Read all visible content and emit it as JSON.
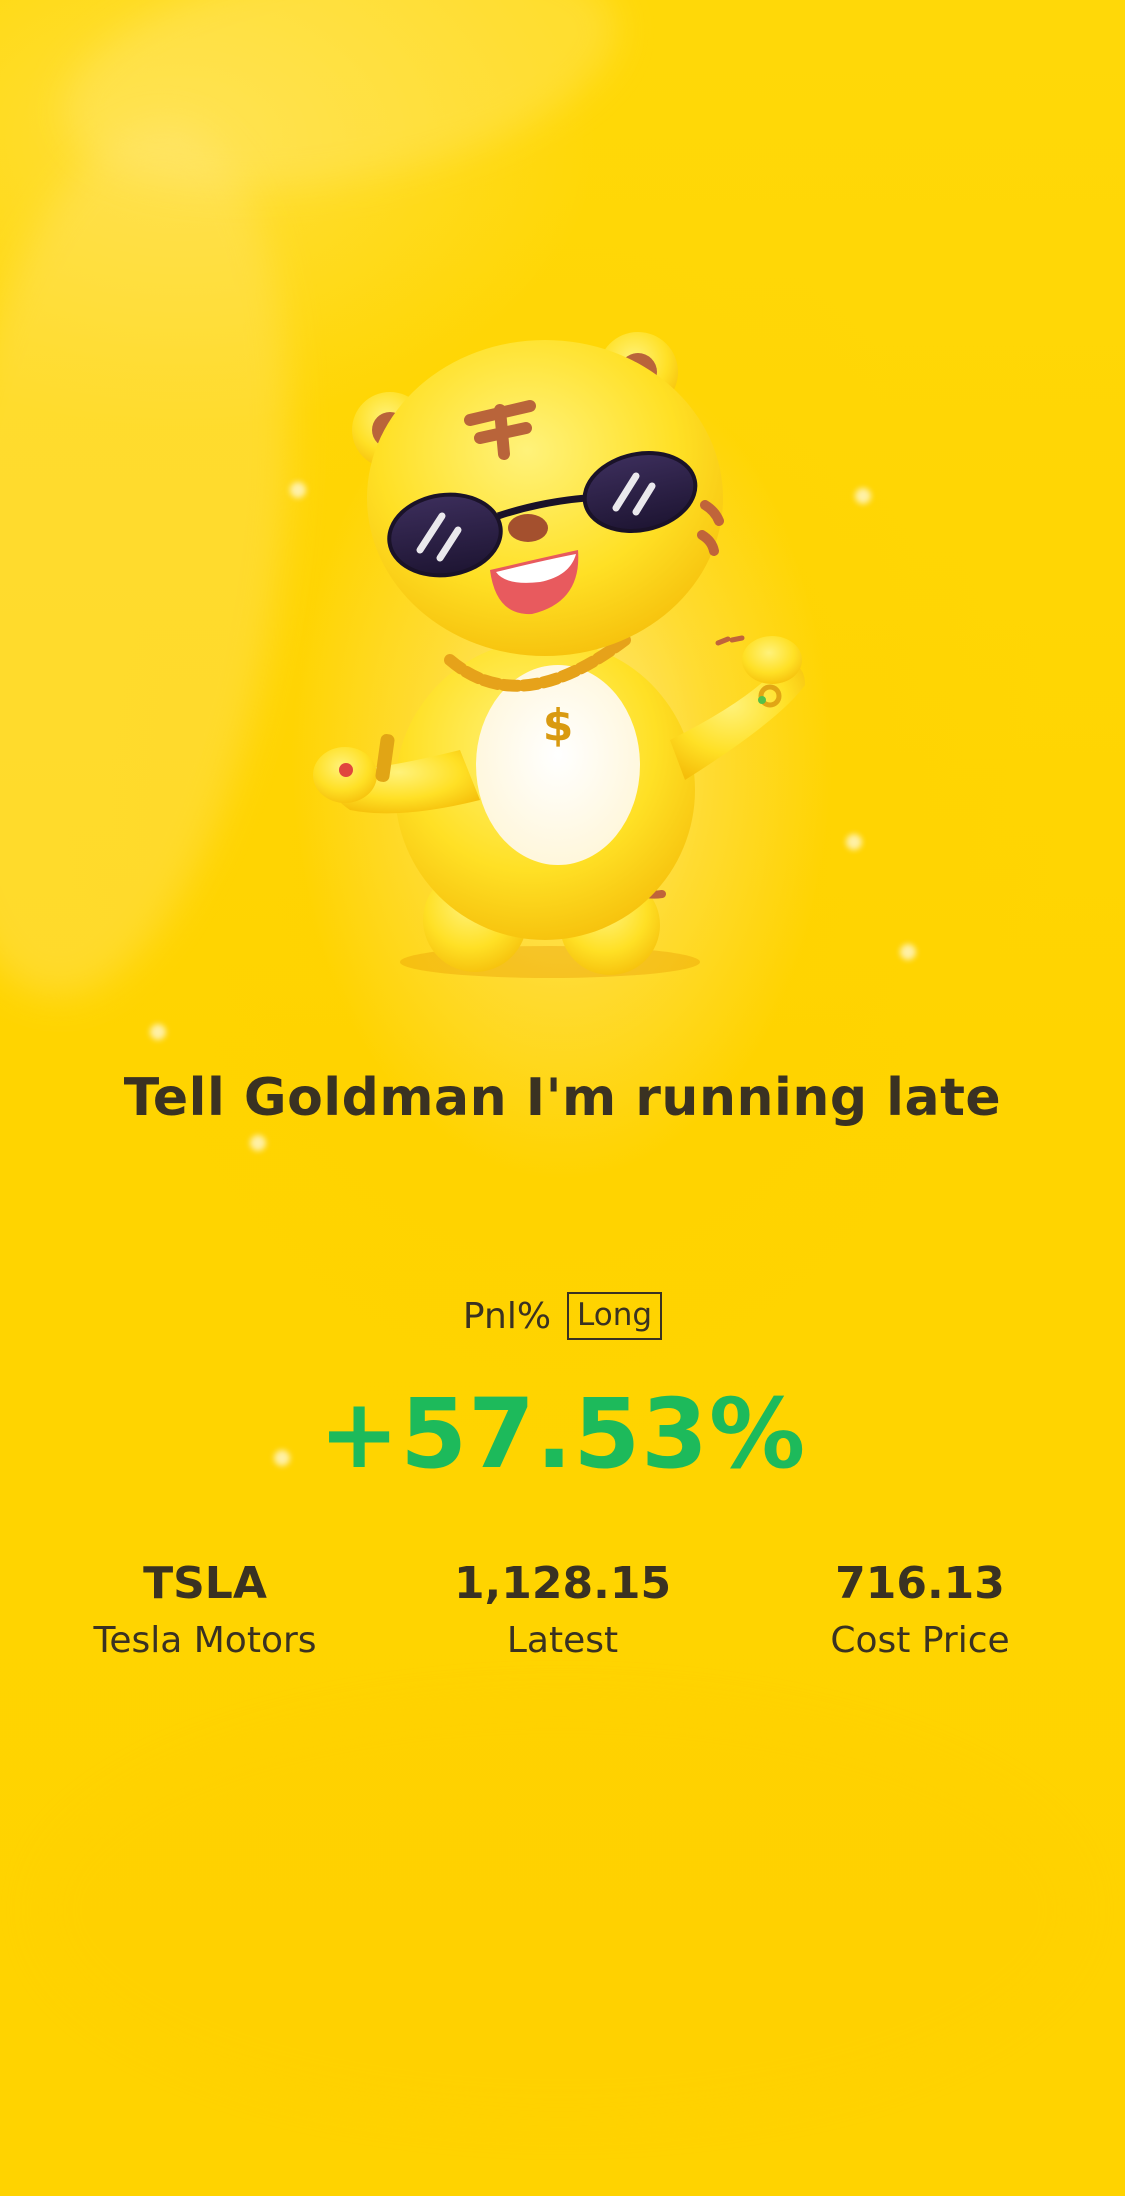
{
  "card": {
    "tagline": "Tell Goldman I'm running late",
    "pnl_label": "Pnl%",
    "position_badge": "Long",
    "pnl_value": "+57.53%",
    "pnl_color": "#1DBA5B",
    "background_color": "#FFD500"
  },
  "mascot": {
    "icon": "tiger-mascot-sunglasses-icon",
    "pendant_symbol": "$"
  },
  "stats": [
    {
      "value": "TSLA",
      "label": "Tesla Motors"
    },
    {
      "value": "1,128.15",
      "label": "Latest"
    },
    {
      "value": "716.13",
      "label": "Cost Price"
    }
  ]
}
